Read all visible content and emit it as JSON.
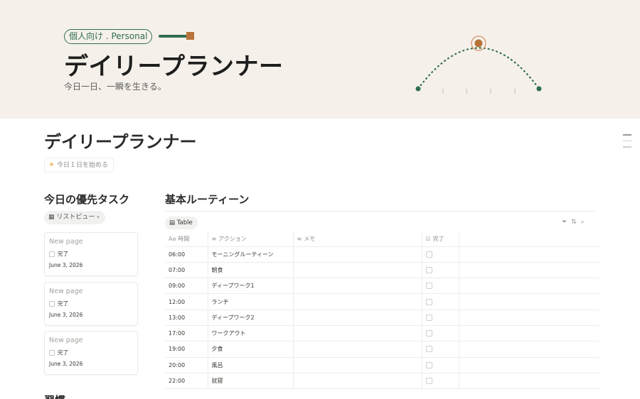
{
  "banner": {
    "tag": "個人向け . Personal",
    "title": "デイリープランナー",
    "subtitle": "今日一日、一瞬を生きる。",
    "colors": {
      "green": "#2f6e53",
      "orange": "#b8733a",
      "background": "#f5f1ea"
    }
  },
  "page": {
    "title": "デイリープランナー",
    "start_button": {
      "icon": "sun-icon",
      "label": "今日１日を始める"
    }
  },
  "priority": {
    "title": "今日の優先タスク",
    "view_label": "リストビュー",
    "cards": [
      {
        "title": "New page",
        "check_label": "完了",
        "date": "June 3, 2026"
      },
      {
        "title": "New page",
        "check_label": "完了",
        "date": "June 3, 2026"
      },
      {
        "title": "New page",
        "check_label": "完了",
        "date": "June 3, 2026"
      }
    ]
  },
  "habits": {
    "title": "習慣"
  },
  "routine": {
    "title": "基本ルーティーン",
    "view_label": "Table",
    "columns": [
      {
        "icon": "Aa",
        "label": "時間"
      },
      {
        "icon": "text-icon",
        "label": "アクション"
      },
      {
        "icon": "text-icon",
        "label": "メモ"
      },
      {
        "icon": "checkbox-icon",
        "label": "完了"
      }
    ],
    "rows": [
      {
        "time": "06:00",
        "action": "モーニングルーティーン",
        "memo": "",
        "done": false
      },
      {
        "time": "07:00",
        "action": "朝食",
        "memo": "",
        "done": false
      },
      {
        "time": "09:00",
        "action": "ディープワーク1",
        "memo": "",
        "done": false
      },
      {
        "time": "12:00",
        "action": "ランチ",
        "memo": "",
        "done": false
      },
      {
        "time": "13:00",
        "action": "ディープワーク2",
        "memo": "",
        "done": false
      },
      {
        "time": "17:00",
        "action": "ワークアウト",
        "memo": "",
        "done": false
      },
      {
        "time": "19:00",
        "action": "夕食",
        "memo": "",
        "done": false
      },
      {
        "time": "20:00",
        "action": "風呂",
        "memo": "",
        "done": false
      },
      {
        "time": "22:00",
        "action": "就寝",
        "memo": "",
        "done": false
      }
    ]
  }
}
